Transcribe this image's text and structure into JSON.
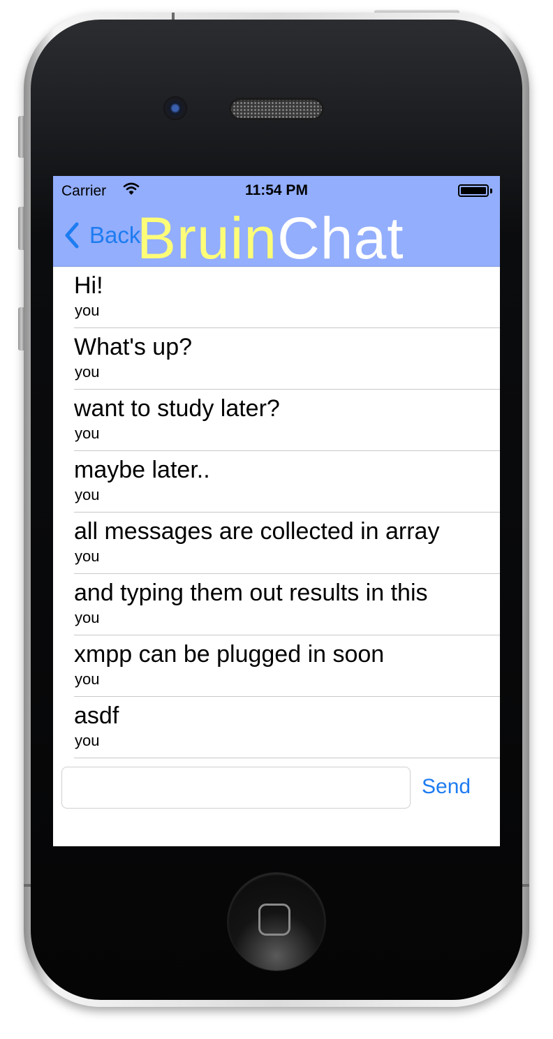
{
  "status_bar": {
    "carrier": "Carrier",
    "time": "11:54 PM",
    "wifi_icon": "wifi-icon",
    "battery_icon": "battery-icon"
  },
  "nav": {
    "back_label": "Back",
    "back_icon": "chevron-left-icon",
    "title_part1": "Bruin",
    "title_part2": "Chat",
    "bar_color": "#93aefc",
    "accent_color": "#1e7cf1",
    "title_part1_color": "#fdfd78",
    "title_part2_color": "#ffffff"
  },
  "messages": [
    {
      "text": "Hi!",
      "sender": "you"
    },
    {
      "text": "What's up?",
      "sender": "you"
    },
    {
      "text": "want to study later?",
      "sender": "you"
    },
    {
      "text": "maybe later..",
      "sender": "you"
    },
    {
      "text": "all messages are collected in array",
      "sender": "you"
    },
    {
      "text": "and typing them out results in this",
      "sender": "you"
    },
    {
      "text": "xmpp can be plugged in soon",
      "sender": "you"
    },
    {
      "text": "asdf",
      "sender": "you"
    }
  ],
  "composer": {
    "input_value": "",
    "placeholder": "",
    "send_label": "Send"
  },
  "device": {
    "home_button_icon": "home-button-icon"
  }
}
